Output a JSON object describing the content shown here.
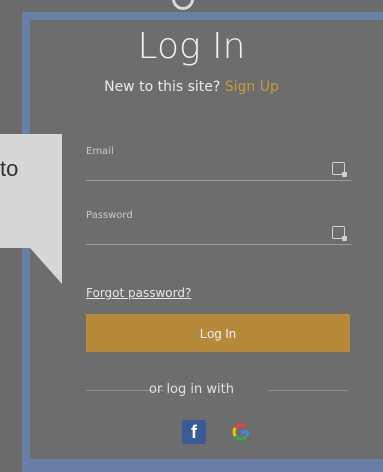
{
  "tooltip": {
    "text": "to"
  },
  "header": {
    "title": "Log In",
    "subtitle_prefix": "New to this site?",
    "signup_label": "Sign Up"
  },
  "form": {
    "email_label": "Email",
    "email_value": "",
    "password_label": "Password",
    "password_value": "",
    "forgot_label": "Forgot password?",
    "login_button_label": "Log In"
  },
  "social": {
    "divider_text": "or log in with",
    "providers": [
      {
        "name": "facebook",
        "icon": "facebook-icon"
      },
      {
        "name": "google",
        "icon": "google-icon"
      }
    ]
  },
  "colors": {
    "accent": "#b7893a",
    "link": "#c79a3a",
    "frame": "#6a7fa6",
    "panel": "#6d6d6d"
  }
}
